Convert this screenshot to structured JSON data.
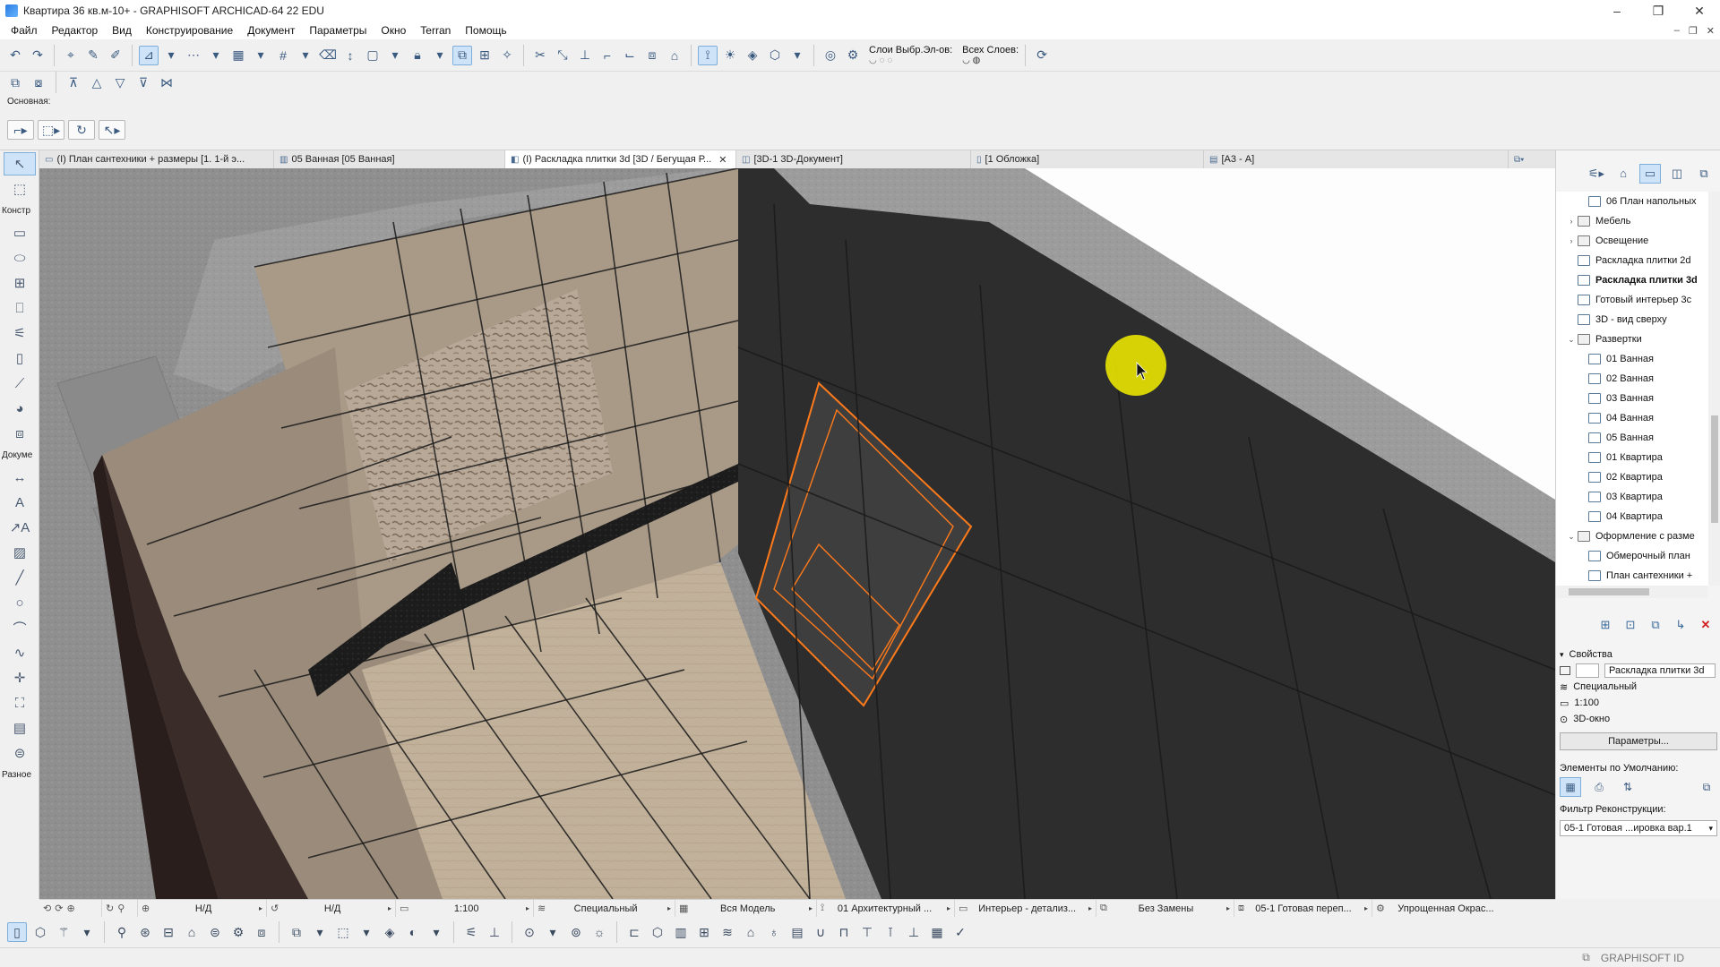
{
  "window": {
    "title": "Квартира 36 кв.м-10+ - GRAPHISOFT ARCHICAD-64 22 EDU",
    "controls": {
      "minimize": "–",
      "maximize": "❐",
      "close": "✕"
    }
  },
  "menu": {
    "items": [
      "Файл",
      "Редактор",
      "Вид",
      "Конструирование",
      "Документ",
      "Параметры",
      "Окно",
      "Terran",
      "Помощь"
    ],
    "doc_controls": [
      "–",
      "❐",
      "✕"
    ]
  },
  "toolbar": {
    "layers_label": "Слои Выбр.Эл-ов:",
    "all_layers_label": "Всех Слоев:"
  },
  "infobox": {
    "label": "Основная:"
  },
  "tabs": [
    {
      "label": "(I) План сантехники + размеры [1. 1-й э...",
      "active": false,
      "icon": "floorplan-icon"
    },
    {
      "label": "05 Ванная [05 Ванная]",
      "active": false,
      "icon": "elevation-icon"
    },
    {
      "label": "(I) Раскладка плитки 3d [3D / Бегущая Р...",
      "active": true,
      "icon": "3d-view-icon",
      "close": "✕"
    },
    {
      "label": "[3D-1 3D-Документ]",
      "active": false,
      "icon": "3d-document-icon"
    },
    {
      "label": "[1 Обложка]",
      "active": false,
      "icon": "layout-icon"
    },
    {
      "label": "[А3 - А]",
      "active": false,
      "icon": "master-layout-icon"
    }
  ],
  "toolbox": {
    "groups": [
      "Констр",
      "Докуме",
      "Разное"
    ]
  },
  "navigator": {
    "tree": [
      {
        "label": "06 План напольных",
        "indent": 2,
        "chev": "",
        "type": "view",
        "bold": false
      },
      {
        "label": "Мебель",
        "indent": 1,
        "chev": "›",
        "type": "folder",
        "bold": false
      },
      {
        "label": "Освещение",
        "indent": 1,
        "chev": "›",
        "type": "folder",
        "bold": false
      },
      {
        "label": "Раскладка плитки 2d",
        "indent": 1,
        "chev": "",
        "type": "view",
        "bold": false
      },
      {
        "label": "Раскладка плитки 3d",
        "indent": 1,
        "chev": "",
        "type": "view",
        "bold": true
      },
      {
        "label": "Готовый интерьер 3c",
        "indent": 1,
        "chev": "",
        "type": "view",
        "bold": false
      },
      {
        "label": "3D - вид сверху",
        "indent": 1,
        "chev": "",
        "type": "view",
        "bold": false
      },
      {
        "label": "Развертки",
        "indent": 1,
        "chev": "⌄",
        "type": "folder",
        "bold": false
      },
      {
        "label": "01 Ванная",
        "indent": 2,
        "chev": "",
        "type": "view",
        "bold": false
      },
      {
        "label": "02 Ванная",
        "indent": 2,
        "chev": "",
        "type": "view",
        "bold": false
      },
      {
        "label": "03 Ванная",
        "indent": 2,
        "chev": "",
        "type": "view",
        "bold": false
      },
      {
        "label": "04 Ванная",
        "indent": 2,
        "chev": "",
        "type": "view",
        "bold": false
      },
      {
        "label": "05 Ванная",
        "indent": 2,
        "chev": "",
        "type": "view",
        "bold": false
      },
      {
        "label": "01 Квартира",
        "indent": 2,
        "chev": "",
        "type": "view",
        "bold": false
      },
      {
        "label": "02 Квартира",
        "indent": 2,
        "chev": "",
        "type": "view",
        "bold": false
      },
      {
        "label": "03 Квартира",
        "indent": 2,
        "chev": "",
        "type": "view",
        "bold": false
      },
      {
        "label": "04 Квартира",
        "indent": 2,
        "chev": "",
        "type": "view",
        "bold": false
      },
      {
        "label": "Оформление с разме",
        "indent": 1,
        "chev": "⌄",
        "type": "folder",
        "bold": false
      },
      {
        "label": "Обмерочный план",
        "indent": 2,
        "chev": "",
        "type": "view",
        "bold": false
      },
      {
        "label": "План сантехники +",
        "indent": 2,
        "chev": "",
        "type": "view",
        "bold": false
      }
    ],
    "properties": {
      "header": "Свойства",
      "name_value": "Раскладка плитки 3d",
      "row1": "Специальный",
      "row2": "1:100",
      "row3": "3D-окно",
      "params_button": "Параметры...",
      "defaults_label": "Элементы по Умолчанию:",
      "filter_label": "Фильтр Реконструкции:",
      "filter_value": "05-1 Готовая ...ировка вар.1"
    }
  },
  "quickbar": {
    "nd1": "Н/Д",
    "nd2": "Н/Д",
    "scale": "1:100",
    "pen_set": "Специальный",
    "model": "Вся Модель",
    "layer_combo": "01 Архитектурный ...",
    "mvo": "Интерьер - детализ...",
    "override": "Без Замены",
    "renovation": "05-1 Готовая переп...",
    "structure": "Упрощенная Окрас..."
  },
  "status": {
    "brand": "GRAPHISOFT ID"
  },
  "colors": {
    "accent": "#cfe3f8",
    "accent_border": "#7eaedc",
    "selection_orange": "#ff7a1a",
    "cursor_highlight": "#f5f000"
  }
}
